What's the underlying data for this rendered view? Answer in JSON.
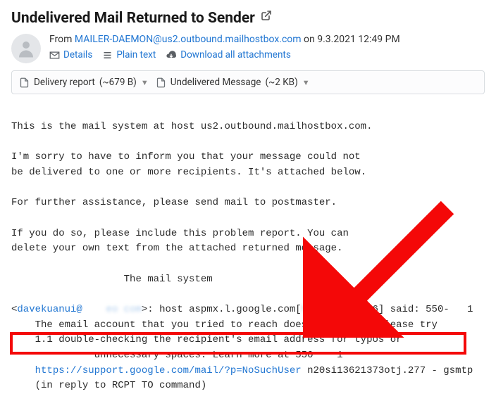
{
  "subject": "Undelivered Mail Returned to Sender",
  "from_label": "From",
  "from_address": "MAILER-DAEMON@us2.outbound.mailhostbox.com",
  "on_label": "on",
  "date": "9.3.2021 12:49 PM",
  "meta": {
    "details": "Details",
    "plaintext": "Plain text",
    "download_all": "Download all attachments"
  },
  "attachments": [
    {
      "name": "Delivery report",
      "size": "(~679 B)"
    },
    {
      "name": "Undelivered Message",
      "size": "(~2 KB)"
    }
  ],
  "body": {
    "l1": "This is the mail system at host us2.outbound.mailhostbox.com.",
    "l2": "I'm sorry to have to inform you that your message could not",
    "l3": "be delivered to one or more recipients. It's attached below.",
    "l4": "For further assistance, please send mail to postmaster.",
    "l5": "If you do so, please include this problem report. You can",
    "l6": "delete your own text from the attached returned message.",
    "l7": "                   The mail system",
    "r_pre": "<",
    "r_email_vis": "davekuanui@",
    "r_email_hid": "    eo com",
    "r_mid": ">: host aspmx.l.google.com[",
    "r_ip_hid": "hidden     ",
    "r_ip_end": "26] said: 550-",
    "r_code_hid": "   ",
    "r_code_end": "1",
    "highlight": "    The email account that you tried to reach does not exist.",
    "after_hl": " Please try",
    "l9": "    1.1 double-checking the recipient's email address for typos or",
    "l10_hid": "         ",
    "l10": " unnecessary spaces. Learn more at 550 ",
    "l10_code_hid": "   ",
    "l10_end": "1",
    "url": "https://support.google.com/mail/?p=NoSuchUser",
    "url_after": " n20si13621373otj.277 - gsmtp",
    "last": "    (in reply to RCPT TO command)"
  }
}
